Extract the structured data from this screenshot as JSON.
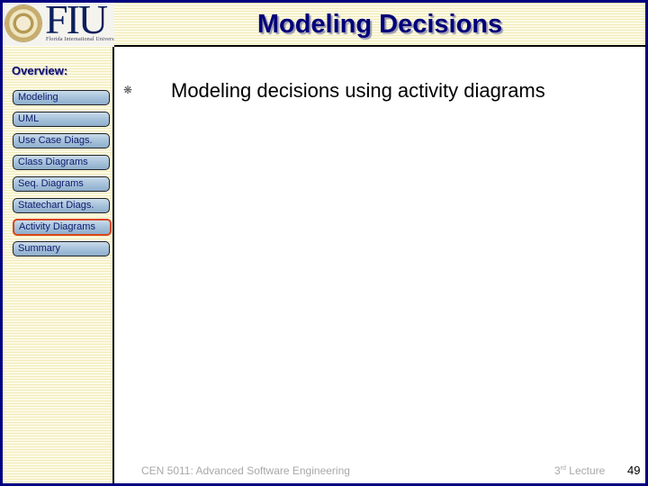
{
  "header": {
    "title": "Modeling Decisions",
    "logo": {
      "name": "FIU",
      "subtitle": "Florida International University"
    }
  },
  "sidebar": {
    "heading": "Overview:",
    "items": [
      {
        "label": "Modeling",
        "active": false
      },
      {
        "label": "UML",
        "active": false
      },
      {
        "label": "Use Case Diags.",
        "active": false
      },
      {
        "label": "Class Diagrams",
        "active": false
      },
      {
        "label": "Seq. Diagrams",
        "active": false
      },
      {
        "label": "Statechart Diags.",
        "active": false
      },
      {
        "label": "Activity Diagrams",
        "active": true
      },
      {
        "label": "Summary",
        "active": false
      }
    ]
  },
  "content": {
    "bullets": [
      {
        "icon": "asterisk-bullet-icon",
        "glyph": "❋",
        "text": "Modeling decisions using activity diagrams"
      }
    ]
  },
  "footer": {
    "course": "CEN 5011: Advanced Software Engineering",
    "lecture_num": "3",
    "lecture_suffix": "rd",
    "lecture_label": "Lecture",
    "page_number": "49"
  },
  "colors": {
    "frame": "#000080",
    "title": "#00007a",
    "active_border": "#d9461a",
    "button_fill": "#a9c4dc",
    "stripe_bg": "#fbf8dc"
  }
}
